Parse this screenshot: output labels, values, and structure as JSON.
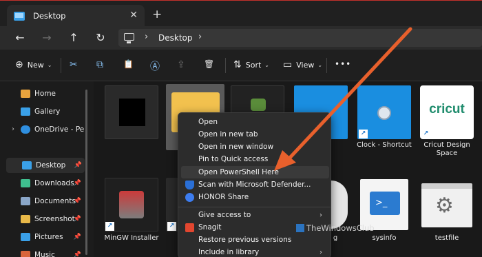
{
  "window": {
    "tab_title": "Desktop",
    "tab_close": "✕",
    "new_tab": "+"
  },
  "nav": {
    "back": "←",
    "forward": "→",
    "up": "↑",
    "refresh": "↻",
    "breadcrumb": "Desktop",
    "chevron": "›"
  },
  "toolbar": {
    "new_label": "New",
    "new_icon": "⊕",
    "sort_label": "Sort",
    "sort_icon": "⇅",
    "view_label": "View",
    "view_icon": "▭",
    "more": "•••",
    "caret": "⌄",
    "cut_icon": "✂",
    "copy_icon": "⧉",
    "paste_icon": "📋",
    "rename_icon": "Ⓐ",
    "share_icon": "⇪",
    "delete_icon": "🗑"
  },
  "sidebar": {
    "items": [
      {
        "label": "Home",
        "icon": "home-icon",
        "color": "#e8a33d"
      },
      {
        "label": "Gallery",
        "icon": "gallery-icon",
        "color": "#3aa0e8"
      },
      {
        "label": "OneDrive - Perso",
        "icon": "onedrive-icon",
        "color": "#2f8fe0"
      },
      {
        "label": "Desktop",
        "icon": "desktop-icon",
        "color": "#3aa0e8",
        "pinned": true
      },
      {
        "label": "Downloads",
        "icon": "downloads-icon",
        "color": "#3fbf8f",
        "pinned": true
      },
      {
        "label": "Documents",
        "icon": "documents-icon",
        "color": "#8aa6c8",
        "pinned": true
      },
      {
        "label": "Screenshot",
        "icon": "folder-icon",
        "color": "#e9b949",
        "pinned": true
      },
      {
        "label": "Pictures",
        "icon": "pictures-icon",
        "color": "#3aa0e8",
        "pinned": true
      },
      {
        "label": "Music",
        "icon": "music-icon",
        "color": "#d9653b",
        "pinned": true
      }
    ],
    "pin_glyph": "📌",
    "expand_glyph": "›"
  },
  "files": [
    {
      "name": "",
      "kind": "black-thumb"
    },
    {
      "name": "",
      "kind": "folder-selected"
    },
    {
      "name": "",
      "kind": "game-icon"
    },
    {
      "name": "- ",
      "kind": "blue-tile"
    },
    {
      "name": "Clock - Shortcut",
      "kind": "clock-tile"
    },
    {
      "name": "Cricut Design Space",
      "kind": "cricut-tile",
      "logo": "cricut"
    },
    {
      "name": "MinGW Installer",
      "kind": "installer"
    },
    {
      "name": "",
      "kind": "folder-partial"
    },
    {
      "name": "g",
      "kind": "partial"
    },
    {
      "name": "sysinfo",
      "kind": "powershell-file"
    },
    {
      "name": "testfile",
      "kind": "gear-file"
    }
  ],
  "context_menu": {
    "items": [
      {
        "label": "Open"
      },
      {
        "label": "Open in new tab"
      },
      {
        "label": "Open in new window"
      },
      {
        "label": "Pin to Quick access"
      },
      {
        "label": "Open PowerShell Here"
      },
      {
        "label": "Scan with Microsoft Defender..."
      },
      {
        "label": "HONOR Share"
      },
      {
        "label": "Give access to"
      },
      {
        "label": "Snagit"
      },
      {
        "label": "Restore previous versions"
      },
      {
        "label": "Include in library"
      }
    ],
    "submenu_arrow": "›"
  },
  "watermark": "TheWindowsClub",
  "colors": {
    "accent": "#3aa0e8",
    "arrow": "#e8602c",
    "tile_blue": "#1a8ee0",
    "cricut_green": "#1f8c6d"
  }
}
